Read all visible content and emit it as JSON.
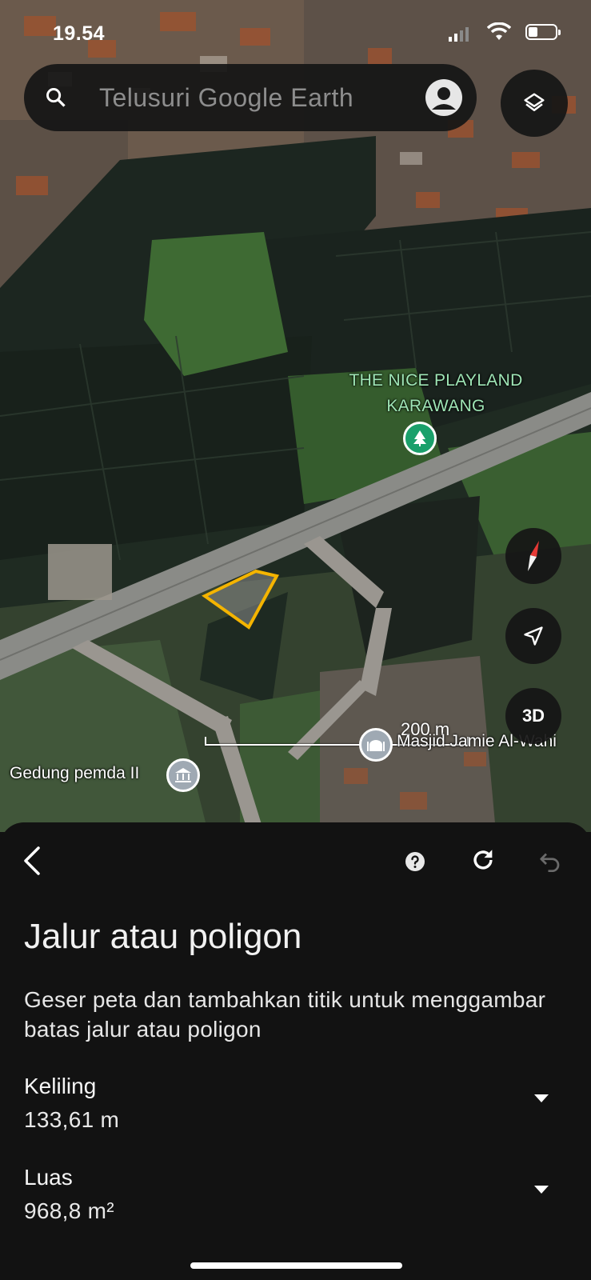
{
  "status_bar": {
    "time": "19.54",
    "battery_level": 0.35
  },
  "search": {
    "placeholder": "Telusuri Google Earth"
  },
  "map": {
    "labels": {
      "playland": "THE NICE PLAYLAND KARAWANG",
      "masjid": "Masjid Jamie Al-Wahi",
      "gedung": "Gedung pemda II"
    },
    "scale_text": "200 m",
    "three_d_label": "3D",
    "polygon_color": "#f4b400"
  },
  "sheet": {
    "title": "Jalur atau poligon",
    "description": "Geser peta dan tambahkan titik untuk menggambar batas jalur atau poligon",
    "metrics": [
      {
        "label": "Keliling",
        "value": "133,61 m"
      },
      {
        "label": "Luas",
        "value": "968,8 m²"
      }
    ]
  },
  "icons": [
    "search-icon",
    "account-icon",
    "layers-icon",
    "compass-icon",
    "my-location-icon",
    "back-arrow-icon",
    "help-icon",
    "refresh-icon",
    "undo-icon",
    "tree-icon",
    "mosque-icon",
    "government-icon",
    "dropdown-caret-icon"
  ]
}
